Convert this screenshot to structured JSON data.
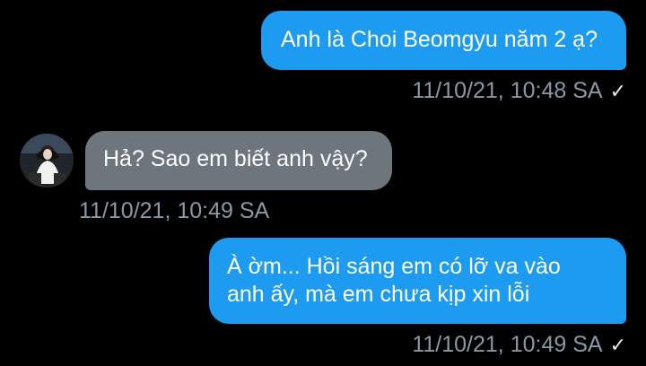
{
  "messages": [
    {
      "text": "Anh là Choi Beomgyu năm 2 ạ?",
      "timestamp": "11/10/21, 10:48 SA",
      "status_icon": "checkmark-icon"
    },
    {
      "text": "Hả? Sao em biết anh vậy?",
      "timestamp": "11/10/21, 10:49 SA",
      "sender_avatar": "avatar-photo"
    },
    {
      "text_line1": "À ờm... Hồi sáng em có lỡ va vào",
      "text_line2": "anh ấy, mà em chưa kịp xin lỗi",
      "timestamp": "11/10/21, 10:49 SA",
      "status_icon": "checkmark-icon"
    }
  ],
  "check_glyph": "✓",
  "colors": {
    "background": "#000000",
    "outgoing_bubble": "#1d9bf0",
    "incoming_bubble": "#6e767d",
    "timestamp": "#8b98a5"
  }
}
